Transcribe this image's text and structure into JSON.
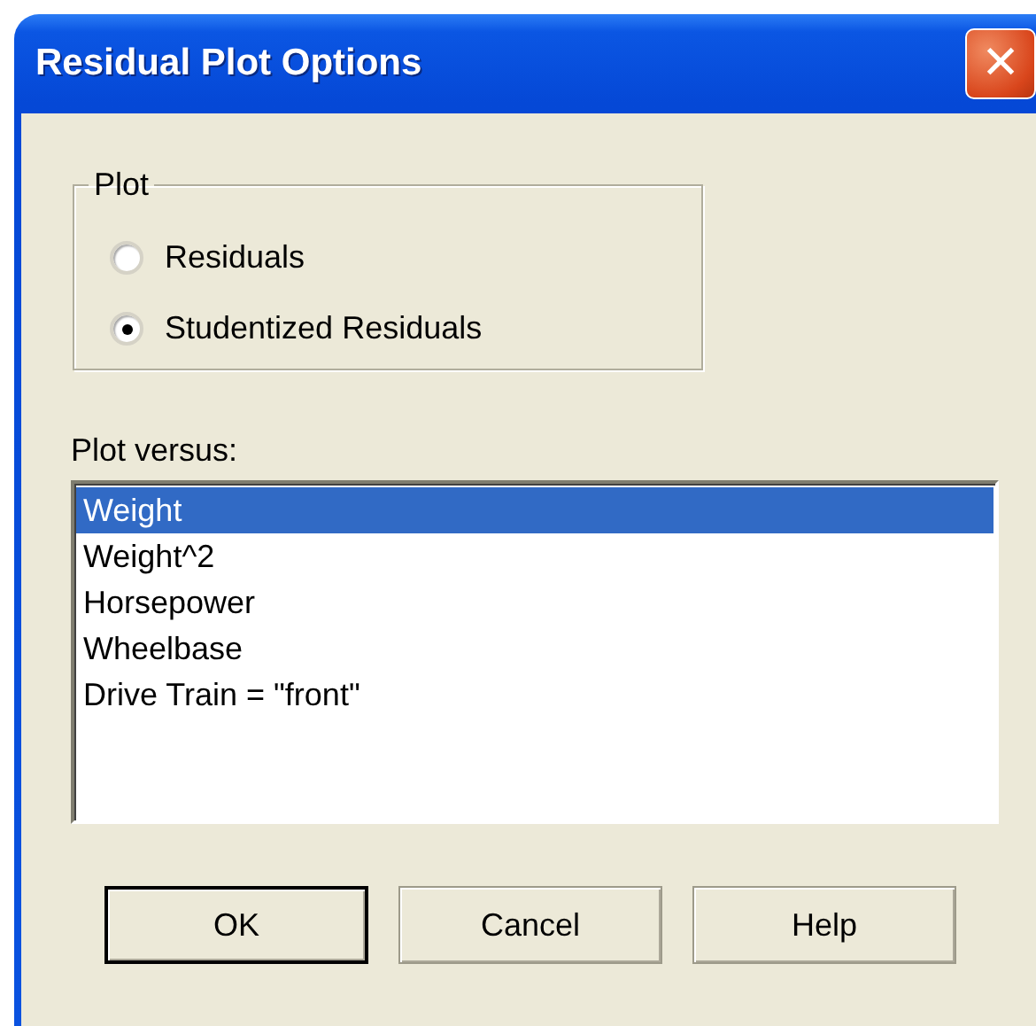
{
  "window": {
    "title": "Residual Plot Options",
    "close_glyph": "✕"
  },
  "plot_group": {
    "label": "Plot",
    "options": [
      {
        "label": "Residuals",
        "selected": false
      },
      {
        "label": "Studentized Residuals",
        "selected": true
      }
    ]
  },
  "plot_versus": {
    "label": "Plot versus:",
    "items": [
      {
        "label": "Weight",
        "selected": true
      },
      {
        "label": "Weight^2",
        "selected": false
      },
      {
        "label": "Horsepower",
        "selected": false
      },
      {
        "label": "Wheelbase",
        "selected": false
      },
      {
        "label": "Drive Train = \"front\"",
        "selected": false
      }
    ]
  },
  "buttons": [
    {
      "label": "OK",
      "default": true
    },
    {
      "label": "Cancel",
      "default": false
    },
    {
      "label": "Help",
      "default": false
    }
  ]
}
